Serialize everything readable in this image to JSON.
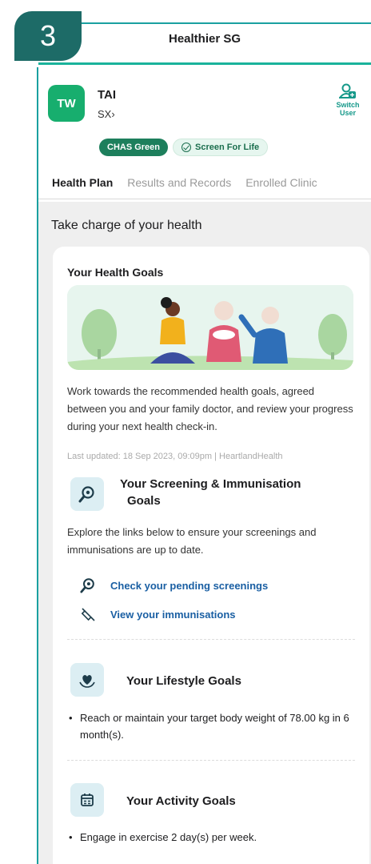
{
  "step_number": "3",
  "app_title": "Healthier SG",
  "profile": {
    "initials": "TW",
    "name": "TAI",
    "id": "SX›",
    "switch_user": [
      "Switch",
      "User"
    ]
  },
  "badges": {
    "chas": "CHAS Green",
    "screen_for_life": "Screen For Life"
  },
  "tabs": [
    "Health Plan",
    "Results and Records",
    "Enrolled Clinic"
  ],
  "section_title": "Take charge of your health",
  "health_goals": {
    "title": "Your Health Goals",
    "description": "Work towards the recommended health goals, agreed between you and your family doctor, and review your progress during your next health check-in.",
    "last_updated": "Last updated: 18 Sep 2023, 09:09pm | HeartlandHealth"
  },
  "screening": {
    "title_line1": "Your Screening & Immunisation",
    "title_line2": "Goals",
    "description": "Explore the links below to ensure your screenings and immunisations are up to date.",
    "link_screenings": "Check your pending screenings",
    "link_immunisations": "View your immunisations"
  },
  "lifestyle": {
    "title": "Your Lifestyle Goals",
    "bullet": "Reach or maintain your target body weight of 78.00 kg in 6 month(s)."
  },
  "activity": {
    "title": "Your Activity Goals",
    "bullet": "Engage in exercise 2 day(s) per week."
  },
  "colors": {
    "frame": "#1aa0a0",
    "badge": "#1d6b67",
    "avatar": "#17ae6e",
    "chip_green": "#1d7f5c",
    "link": "#1a5fa3",
    "icon_bg": "#dceef3"
  }
}
